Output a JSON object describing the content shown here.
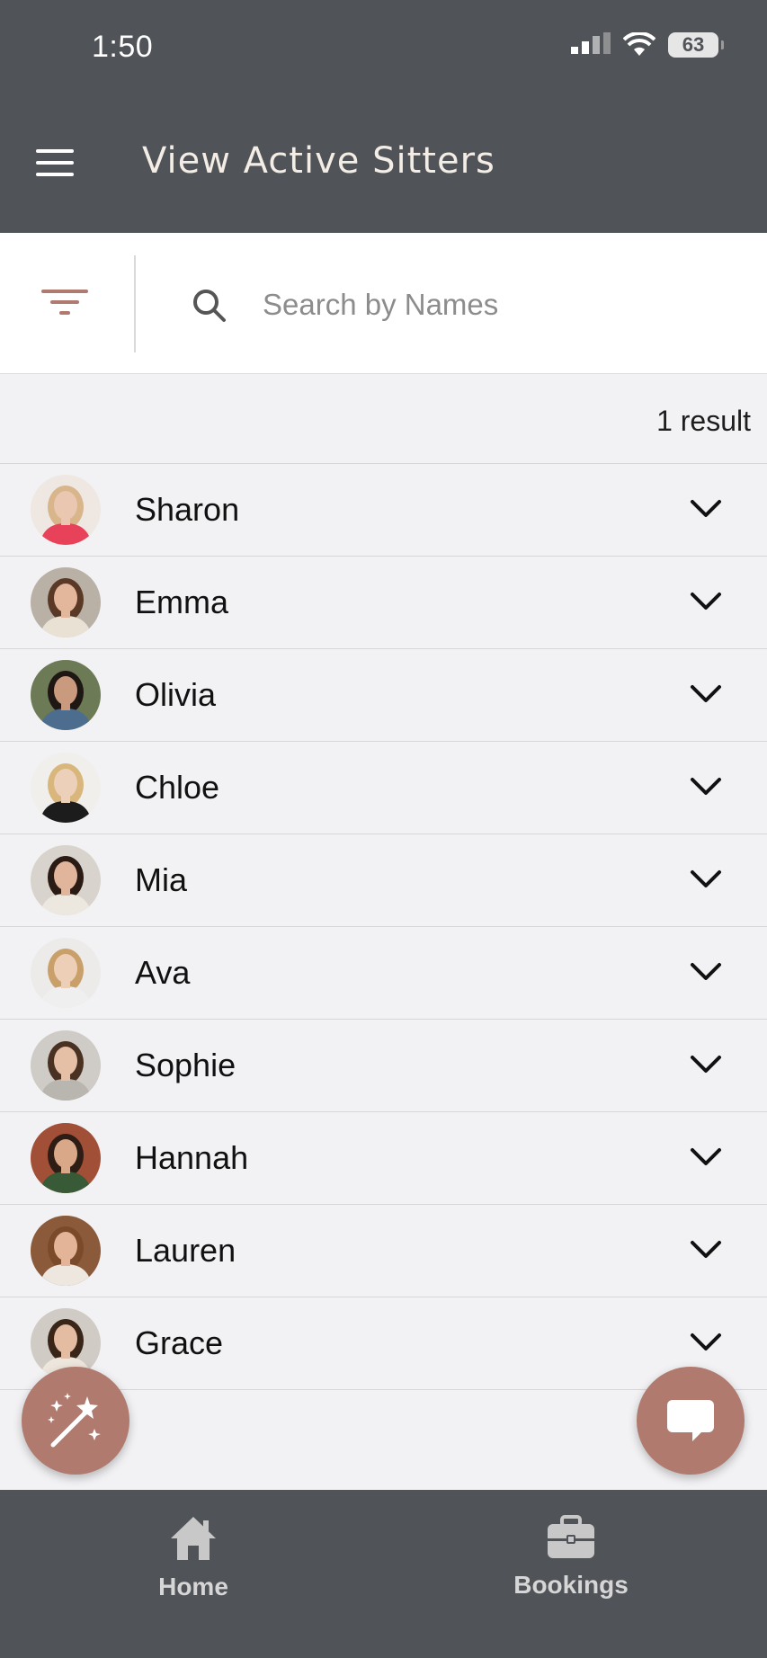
{
  "status_bar": {
    "time": "1:50",
    "battery": "63"
  },
  "header": {
    "title": "View Active Sitters"
  },
  "search": {
    "placeholder": "Search by Names",
    "value": ""
  },
  "results": {
    "count_label": "1  result"
  },
  "sitters": [
    {
      "name": "Sharon",
      "skin": "#e9c7b0",
      "hair": "#d8b58a",
      "shirt": "#e8425b",
      "bg": "#efe7e2"
    },
    {
      "name": "Emma",
      "skin": "#e2b79c",
      "hair": "#5a3a26",
      "shirt": "#e9e1d3",
      "bg": "#b9b0a6"
    },
    {
      "name": "Olivia",
      "skin": "#c99a7d",
      "hair": "#1f1714",
      "shirt": "#4c6d8e",
      "bg": "#6c7a56"
    },
    {
      "name": "Chloe",
      "skin": "#edd0b9",
      "hair": "#d9b67b",
      "shirt": "#1c1c1c",
      "bg": "#f1efec"
    },
    {
      "name": "Mia",
      "skin": "#e0b59b",
      "hair": "#2a1b14",
      "shirt": "#ece7df",
      "bg": "#d8d3cc"
    },
    {
      "name": "Ava",
      "skin": "#edcfb7",
      "hair": "#c9a06a",
      "shirt": "#efefef",
      "bg": "#ecebe9"
    },
    {
      "name": "Sophie",
      "skin": "#e6c0a6",
      "hair": "#4a3222",
      "shirt": "#b9b6b0",
      "bg": "#cfcbc6"
    },
    {
      "name": "Hannah",
      "skin": "#d9a888",
      "hair": "#2e1d14",
      "shirt": "#385a36",
      "bg": "#a24f37"
    },
    {
      "name": "Lauren",
      "skin": "#e3b497",
      "hair": "#7a4a2a",
      "shirt": "#ede7df",
      "bg": "#8a5a3a"
    },
    {
      "name": "Grace",
      "skin": "#e4bca2",
      "hair": "#3a2519",
      "shirt": "#ede6dc",
      "bg": "#d0cbc4"
    }
  ],
  "nav": {
    "home_label": "Home",
    "bookings_label": "Bookings"
  },
  "colors": {
    "header_bg": "#505357",
    "accent": "#b07a6f",
    "filter_icon": "#b07a6f"
  }
}
